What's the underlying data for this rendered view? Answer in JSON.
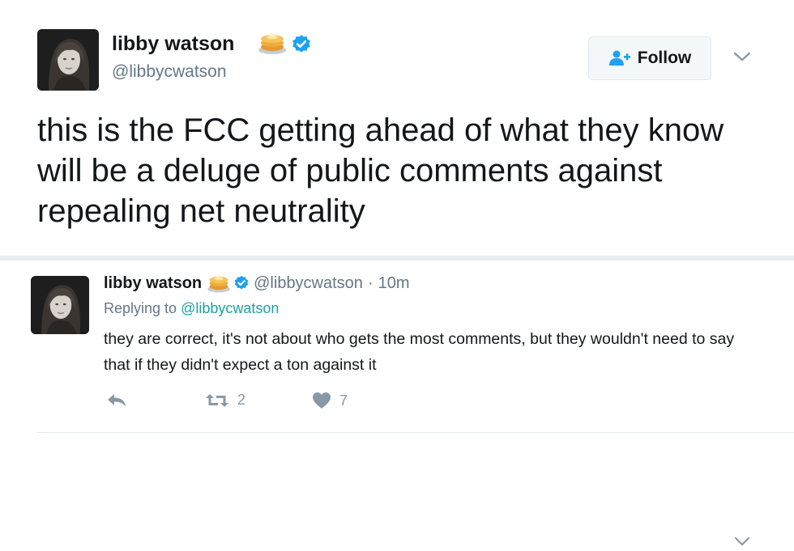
{
  "colors": {
    "verified": "#1da1f2",
    "secondary_text": "#657786",
    "link": "#1da1a5",
    "action_icon": "#8899a6",
    "divider": "#e6ecf0"
  },
  "main_tweet": {
    "display_name": "libby watson",
    "name_emoji": "pancakes-emoji",
    "verified_icon": "verified-badge-icon",
    "handle": "@libbycwatson",
    "follow_label": "Follow",
    "follow_icon": "add-user-icon",
    "menu_icon": "chevron-down-icon",
    "text": "this is the FCC getting ahead of what they know will be a deluge of public comments against repealing net neutrality"
  },
  "reply_tweet": {
    "display_name": "libby watson",
    "name_emoji": "pancakes-emoji",
    "verified_icon": "verified-badge-icon",
    "handle": "@libbycwatson",
    "separator": "·",
    "time": "10m",
    "replying_prefix": "Replying to",
    "replying_to": "@libbycwatson",
    "text": "they are correct, it's not about who gets the most comments, but they wouldn't need to say that if they didn't expect a ton against it",
    "menu_icon": "chevron-down-icon",
    "actions": {
      "reply_icon": "reply-icon",
      "retweet_icon": "retweet-icon",
      "retweet_count": "2",
      "like_icon": "heart-icon",
      "like_count": "7"
    }
  }
}
